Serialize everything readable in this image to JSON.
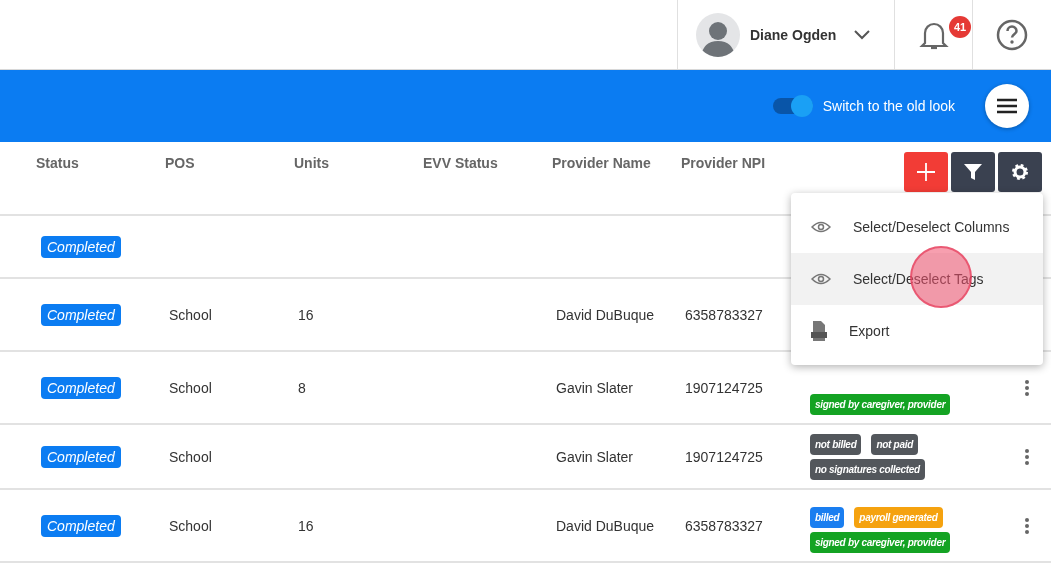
{
  "user": {
    "name": "Diane Ogden"
  },
  "notifications": {
    "count": "41"
  },
  "toolbar": {
    "switch_label": "Switch to the old look",
    "switch_on": true
  },
  "table": {
    "columns": [
      "Status",
      "POS",
      "Units",
      "EVV Status",
      "Provider Name",
      "Provider NPI"
    ],
    "rows": [
      {
        "status": "Completed",
        "pos": "",
        "units": "",
        "evv": "",
        "provider": "",
        "npi": "",
        "tags": []
      },
      {
        "status": "Completed",
        "pos": "School",
        "units": "16",
        "evv": "",
        "provider": "David DuBuque",
        "npi": "6358783327",
        "tags": []
      },
      {
        "status": "Completed",
        "pos": "School",
        "units": "8",
        "evv": "",
        "provider": "Gavin Slater",
        "npi": "1907124725",
        "tags": [
          {
            "label": "signed by caregiver, provider",
            "color": "#14a323"
          }
        ]
      },
      {
        "status": "Completed",
        "pos": "School",
        "units": "",
        "evv": "",
        "provider": "Gavin Slater",
        "npi": "1907124725",
        "tags": [
          {
            "label": "not billed",
            "color": "#53575c"
          },
          {
            "label": "not paid",
            "color": "#53575c"
          },
          {
            "label": "no signatures collected",
            "color": "#53575c"
          }
        ]
      },
      {
        "status": "Completed",
        "pos": "School",
        "units": "16",
        "evv": "",
        "provider": "David DuBuque",
        "npi": "6358783327",
        "tags": [
          {
            "label": "billed",
            "color": "#1a7ef0"
          },
          {
            "label": "payroll generated",
            "color": "#f5a20f"
          },
          {
            "label": "signed by caregiver, provider",
            "color": "#14a323"
          }
        ]
      }
    ]
  },
  "menu": {
    "items": [
      {
        "label": "Select/Deselect Columns",
        "kind": "eye",
        "selected": false
      },
      {
        "label": "Select/Deselect Tags",
        "kind": "eye",
        "selected": true
      },
      {
        "label": "Export",
        "kind": "file",
        "selected": false
      }
    ]
  }
}
